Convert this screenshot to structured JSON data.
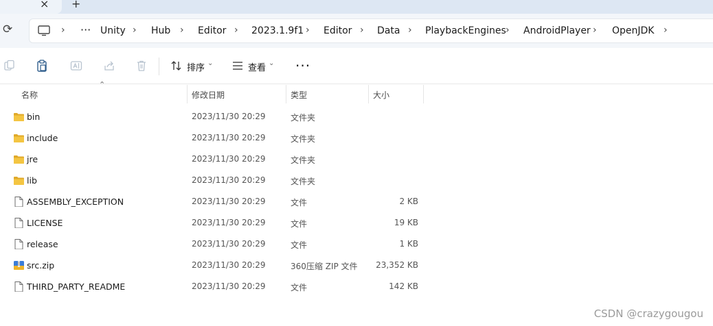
{
  "tabbar": {
    "close_glyph": "×",
    "new_tab_glyph": "+"
  },
  "breadcrumb": {
    "items": [
      "Unity",
      "Hub",
      "Editor",
      "2023.1.9f1",
      "Editor",
      "Data",
      "PlaybackEngines",
      "AndroidPlayer",
      "OpenJDK"
    ],
    "overflow": "···"
  },
  "toolbar": {
    "sort_label": "排序",
    "view_label": "查看",
    "more": "···"
  },
  "columns": {
    "name": "名称",
    "date": "修改日期",
    "type": "类型",
    "size": "大小"
  },
  "files": [
    {
      "name": "bin",
      "date": "2023/11/30 20:29",
      "type": "文件夹",
      "size": "",
      "icon": "folder-icon"
    },
    {
      "name": "include",
      "date": "2023/11/30 20:29",
      "type": "文件夹",
      "size": "",
      "icon": "folder-icon"
    },
    {
      "name": "jre",
      "date": "2023/11/30 20:29",
      "type": "文件夹",
      "size": "",
      "icon": "folder-icon"
    },
    {
      "name": "lib",
      "date": "2023/11/30 20:29",
      "type": "文件夹",
      "size": "",
      "icon": "folder-icon"
    },
    {
      "name": "ASSEMBLY_EXCEPTION",
      "date": "2023/11/30 20:29",
      "type": "文件",
      "size": "2 KB",
      "icon": "file-icon"
    },
    {
      "name": "LICENSE",
      "date": "2023/11/30 20:29",
      "type": "文件",
      "size": "19 KB",
      "icon": "file-icon"
    },
    {
      "name": "release",
      "date": "2023/11/30 20:29",
      "type": "文件",
      "size": "1 KB",
      "icon": "file-icon"
    },
    {
      "name": "src.zip",
      "date": "2023/11/30 20:29",
      "type": "360压缩 ZIP 文件",
      "size": "23,352 KB",
      "icon": "zip-icon"
    },
    {
      "name": "THIRD_PARTY_README",
      "date": "2023/11/30 20:29",
      "type": "文件",
      "size": "142 KB",
      "icon": "file-icon"
    }
  ],
  "watermark": "CSDN @crazygougou",
  "colors": {
    "folder": "#f4c542",
    "folder_dark": "#e0a92a",
    "tabbar": "#dde7f3",
    "accent": "#1a73e8"
  }
}
